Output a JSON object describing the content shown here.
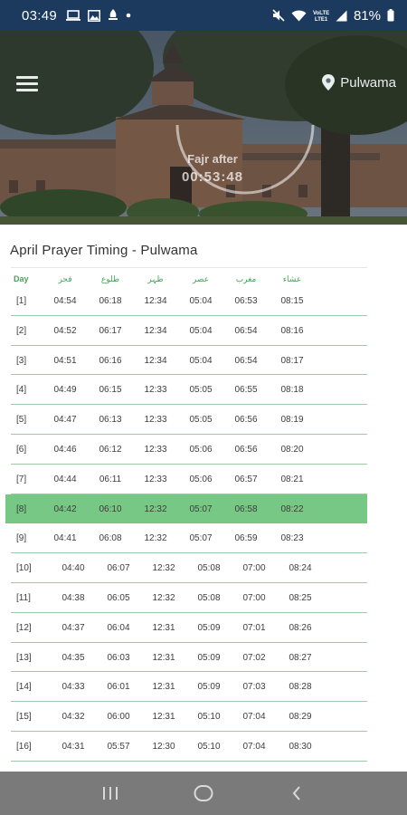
{
  "status_bar": {
    "time": "03:49",
    "battery_text": "81%",
    "left_icons": [
      "laptop-icon",
      "image-icon",
      "app-icon",
      "dot-icon"
    ],
    "right_icons": [
      "mute-icon",
      "wifi-icon",
      "volte-icon",
      "signal-icon",
      "battery-icon"
    ],
    "lte_text": "VoLTE"
  },
  "header": {
    "location": "Pulwama",
    "countdown_label": "Fajr after",
    "countdown_time": "00:53:48",
    "menu_icon": "hamburger-menu-icon",
    "location_icon": "location-pin-icon"
  },
  "timing": {
    "title": "April Prayer Timing - Pulwama",
    "headers": [
      "Day",
      "فجر",
      "طلوع",
      "ظہر",
      "عصر",
      "مغرب",
      "عشاء"
    ],
    "rows": [
      [
        "[1]",
        "04:54",
        "06:18",
        "12:34",
        "05:04",
        "06:53",
        "08:15"
      ],
      [
        "[2]",
        "04:52",
        "06:17",
        "12:34",
        "05:04",
        "06:54",
        "08:16"
      ],
      [
        "[3]",
        "04:51",
        "06:16",
        "12:34",
        "05:04",
        "06:54",
        "08:17"
      ],
      [
        "[4]",
        "04:49",
        "06:15",
        "12:33",
        "05:05",
        "06:55",
        "08:18"
      ],
      [
        "[5]",
        "04:47",
        "06:13",
        "12:33",
        "05:05",
        "06:56",
        "08:19"
      ],
      [
        "[6]",
        "04:46",
        "06:12",
        "12:33",
        "05:06",
        "06:56",
        "08:20"
      ],
      [
        "[7]",
        "04:44",
        "06:11",
        "12:33",
        "05:06",
        "06:57",
        "08:21"
      ],
      [
        "[8]",
        "04:42",
        "06:10",
        "12:32",
        "05:07",
        "06:58",
        "08:22"
      ],
      [
        "[9]",
        "04:41",
        "06:08",
        "12:32",
        "05:07",
        "06:59",
        "08:23"
      ],
      [
        "[10]",
        "04:40",
        "06:07",
        "12:32",
        "05:08",
        "07:00",
        "08:24"
      ],
      [
        "[11]",
        "04:38",
        "06:05",
        "12:32",
        "05:08",
        "07:00",
        "08:25"
      ],
      [
        "[12]",
        "04:37",
        "06:04",
        "12:31",
        "05:09",
        "07:01",
        "08:26"
      ],
      [
        "[13]",
        "04:35",
        "06:03",
        "12:31",
        "05:09",
        "07:02",
        "08:27"
      ],
      [
        "[14]",
        "04:33",
        "06:01",
        "12:31",
        "05:09",
        "07:03",
        "08:28"
      ],
      [
        "[15]",
        "04:32",
        "06:00",
        "12:31",
        "05:10",
        "07:04",
        "08:29"
      ],
      [
        "[16]",
        "04:31",
        "05:57",
        "12:30",
        "05:10",
        "07:04",
        "08:30"
      ]
    ],
    "highlight_index": 7
  },
  "nav_bar": {
    "icons": [
      "recent-apps-icon",
      "home-icon",
      "back-icon"
    ]
  },
  "colors": {
    "status_bar": "#1b3a5e",
    "accent_green": "#77c785",
    "divider_green": "#9ec9a4",
    "header_text_green": "#4aa05c",
    "nav_bar": "#7a7a7a"
  }
}
